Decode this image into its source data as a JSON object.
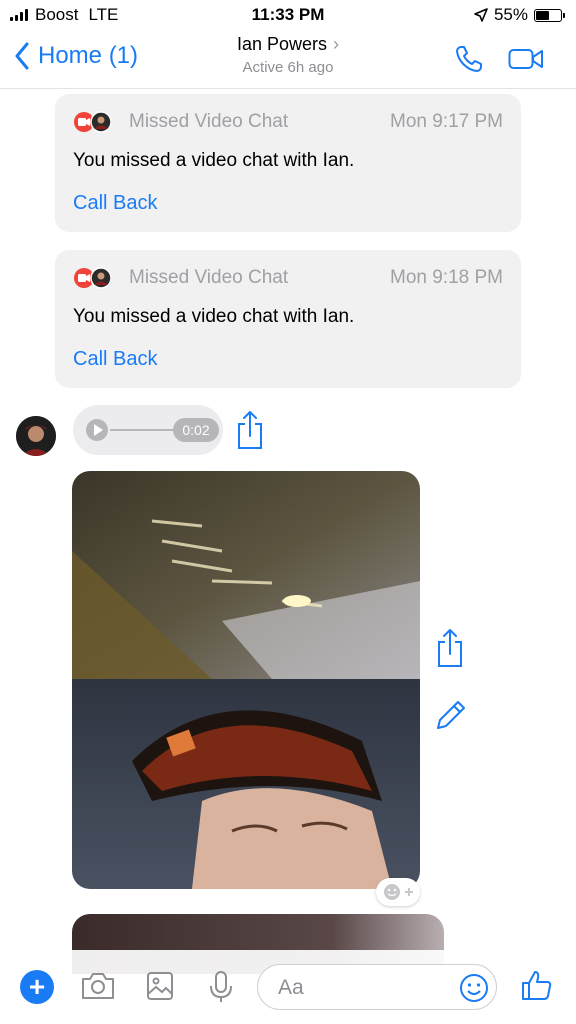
{
  "status": {
    "carrier": "Boost",
    "network": "LTE",
    "time": "11:33 PM",
    "battery": "55%",
    "battery_level": 0.55
  },
  "nav": {
    "back_label": "Home (1)",
    "contact_name": "Ian Powers",
    "contact_status": "Active 6h ago"
  },
  "messages": [
    {
      "label": "Missed Video Chat",
      "time": "Mon 9:17 PM",
      "text": "You missed a video chat with Ian.",
      "action": "Call Back"
    },
    {
      "label": "Missed Video Chat",
      "time": "Mon 9:18 PM",
      "text": "You missed a video chat with Ian.",
      "action": "Call Back"
    }
  ],
  "audio": {
    "duration": "0:02"
  },
  "composer": {
    "placeholder": "Aa"
  },
  "colors": {
    "accent": "#1a7cf4",
    "missed": "#f0443a"
  }
}
